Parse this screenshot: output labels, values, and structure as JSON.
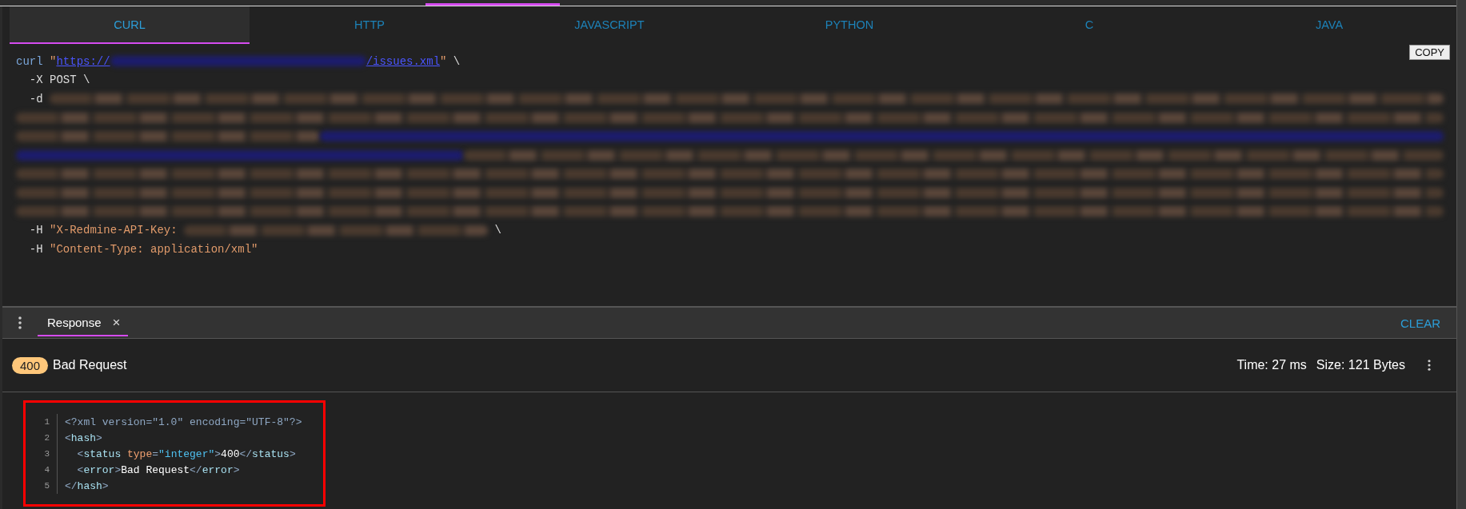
{
  "request_tabs": [
    {
      "label": "CURL",
      "selected": true
    },
    {
      "label": "HTTP",
      "selected": false
    },
    {
      "label": "JAVASCRIPT",
      "selected": false
    },
    {
      "label": "PYTHON",
      "selected": false
    },
    {
      "label": "C",
      "selected": false
    },
    {
      "label": "JAVA",
      "selected": false
    }
  ],
  "copy_button": "COPY",
  "request_code": [
    [
      {
        "kind": "keyword",
        "text": "curl"
      },
      {
        "kind": "string",
        "text": " \""
      },
      {
        "kind": "link",
        "text": "https://"
      },
      {
        "kind": "redacted_link"
      },
      {
        "kind": "link",
        "text": "/issues.xml"
      },
      {
        "kind": "string",
        "text": "\""
      },
      {
        "kind": "plain",
        "text": " \\"
      }
    ],
    [
      {
        "kind": "plain",
        "text": "  -X POST \\"
      }
    ],
    [
      {
        "kind": "plain",
        "text": "  -d "
      },
      {
        "kind": "redacted"
      }
    ],
    [
      {
        "kind": "redacted"
      }
    ],
    [
      {
        "kind": "redacted"
      },
      {
        "kind": "redacted_link"
      }
    ],
    [
      {
        "kind": "redacted_link"
      },
      {
        "kind": "redacted"
      }
    ],
    [
      {
        "kind": "redacted"
      }
    ],
    [
      {
        "kind": "redacted"
      }
    ],
    [
      {
        "kind": "redacted"
      }
    ],
    [
      {
        "kind": "plain",
        "text": "  -H "
      },
      {
        "kind": "string",
        "text": "\"X-Redmine-API-Key: "
      },
      {
        "kind": "redacted"
      },
      {
        "kind": "plain",
        "text": " \\"
      }
    ],
    [
      {
        "kind": "plain",
        "text": "  -H "
      },
      {
        "kind": "string",
        "text": "\"Content-Type: application/xml\""
      }
    ]
  ],
  "response_tab": {
    "label": "Response",
    "selected": true,
    "close": "×"
  },
  "clear_button": "CLEAR",
  "status": {
    "code": "400",
    "text": "Bad Request",
    "time": "Time: 27 ms",
    "size": "Size: 121 Bytes"
  },
  "response_body": [
    {
      "number": "1",
      "segments": [
        {
          "kind": "punct",
          "text": "<?xml version=\"1.0\" encoding=\"UTF-8\"?>"
        }
      ]
    },
    {
      "number": "2",
      "segments": [
        {
          "kind": "punct",
          "text": "<"
        },
        {
          "kind": "tag",
          "text": "hash"
        },
        {
          "kind": "punct",
          "text": ">"
        }
      ]
    },
    {
      "number": "3",
      "segments": [
        {
          "kind": "punct",
          "text": "  <"
        },
        {
          "kind": "tag",
          "text": "status"
        },
        {
          "kind": "attr",
          "text": " type"
        },
        {
          "kind": "punct",
          "text": "="
        },
        {
          "kind": "value",
          "text": "\"integer\""
        },
        {
          "kind": "punct",
          "text": ">"
        },
        {
          "kind": "text",
          "text": "400"
        },
        {
          "kind": "punct",
          "text": "</"
        },
        {
          "kind": "tag",
          "text": "status"
        },
        {
          "kind": "punct",
          "text": ">"
        }
      ]
    },
    {
      "number": "4",
      "segments": [
        {
          "kind": "punct",
          "text": "  <"
        },
        {
          "kind": "tag",
          "text": "error"
        },
        {
          "kind": "punct",
          "text": ">"
        },
        {
          "kind": "text",
          "text": "Bad Request"
        },
        {
          "kind": "punct",
          "text": "</"
        },
        {
          "kind": "tag",
          "text": "error"
        },
        {
          "kind": "punct",
          "text": ">"
        }
      ]
    },
    {
      "number": "5",
      "segments": [
        {
          "kind": "punct",
          "text": "</"
        },
        {
          "kind": "tag",
          "text": "hash"
        },
        {
          "kind": "punct",
          "text": ">"
        }
      ]
    }
  ]
}
